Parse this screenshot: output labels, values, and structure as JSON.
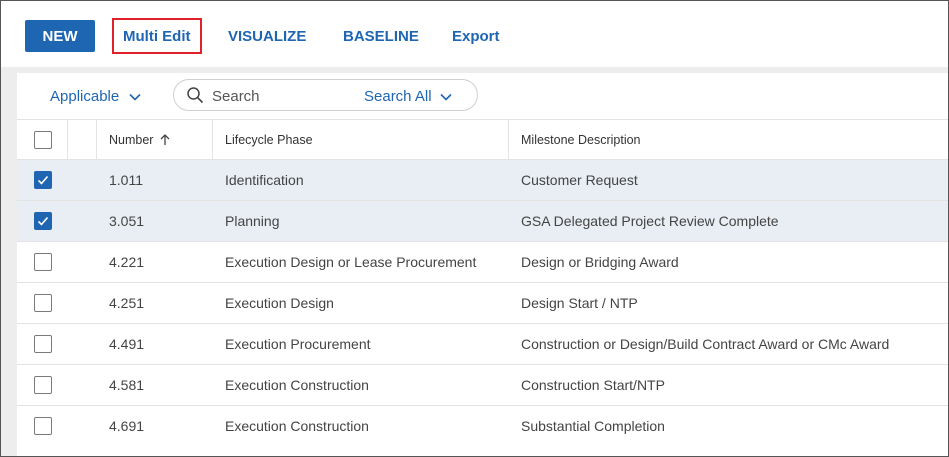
{
  "toolbar": {
    "new_label": "NEW",
    "multi_edit_label": "Multi Edit",
    "visualize_label": "VISUALIZE",
    "baseline_label": "BASELINE",
    "export_label": "Export",
    "highlight_color": "#e0202a",
    "accent_color": "#1f66b2"
  },
  "filter": {
    "applicable_label": "Applicable",
    "search_placeholder": "Search",
    "search_scope_label": "Search All"
  },
  "table": {
    "columns": {
      "number": "Number",
      "lifecycle_phase": "Lifecycle Phase",
      "milestone_description": "Milestone Description"
    },
    "sort": {
      "column": "number",
      "direction": "ascending",
      "icon": "arrow-up-icon"
    },
    "rows": [
      {
        "checked": true,
        "number": "1.011",
        "phase": "Identification",
        "milestone": "Customer Request"
      },
      {
        "checked": true,
        "number": "3.051",
        "phase": "Planning",
        "milestone": "GSA Delegated Project Review Complete"
      },
      {
        "checked": false,
        "number": "4.221",
        "phase": "Execution Design or Lease Procurement",
        "milestone": "Design or Bridging Award"
      },
      {
        "checked": false,
        "number": "4.251",
        "phase": "Execution Design",
        "milestone": "Design Start / NTP"
      },
      {
        "checked": false,
        "number": "4.491",
        "phase": "Execution Procurement",
        "milestone": "Construction or Design/Build Contract Award or CMc Award"
      },
      {
        "checked": false,
        "number": "4.581",
        "phase": "Execution Construction",
        "milestone": "Construction Start/NTP"
      },
      {
        "checked": false,
        "number": "4.691",
        "phase": "Execution Construction",
        "milestone": "Substantial Completion"
      }
    ]
  }
}
